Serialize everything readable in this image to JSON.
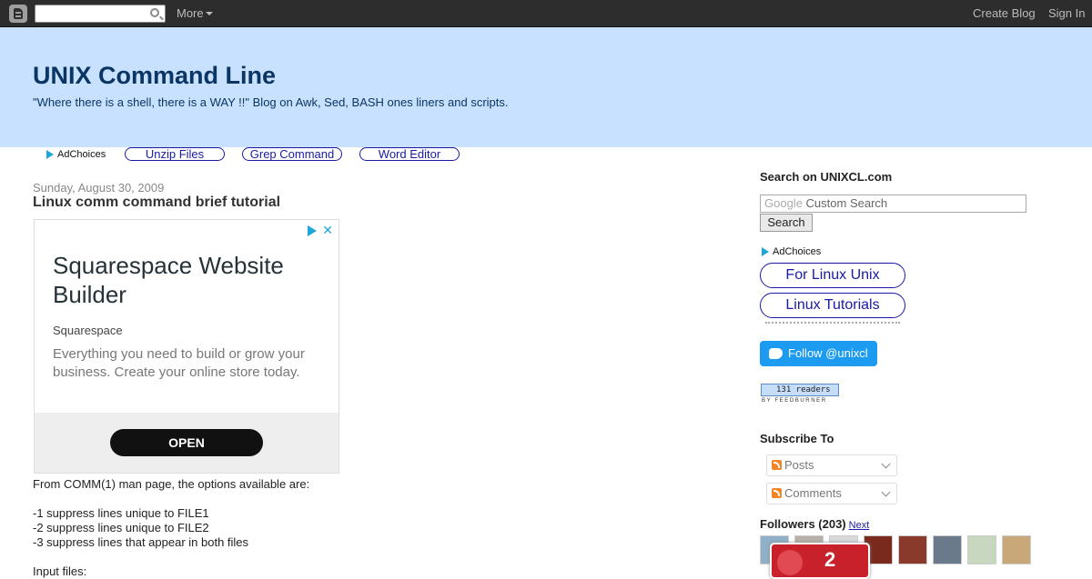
{
  "navbar": {
    "more_label": "More",
    "create_blog_label": "Create Blog",
    "sign_in_label": "Sign In"
  },
  "header": {
    "title": "UNIX Command Line",
    "description": "\"Where there is a shell, there is a WAY !!\" Blog on Awk, Sed, BASH ones liners and scripts."
  },
  "top_ad_links": {
    "adchoices_label": "AdChoices",
    "links": [
      "Unzip Files",
      "Grep Command",
      "Word Editor"
    ]
  },
  "post": {
    "date": "Sunday, August 30, 2009",
    "title": "Linux comm command brief tutorial",
    "body_lines": [
      "From COMM(1) man page, the options available are:",
      "",
      "-1 suppress lines unique to FILE1",
      "-2 suppress lines unique to FILE2",
      "-3 suppress lines that appear in both files",
      "",
      "Input files:"
    ]
  },
  "ad": {
    "headline": "Squarespace Website Builder",
    "advertiser": "Squarespace",
    "body": "Everything you need to build or grow your business. Create your online store today.",
    "cta": "OPEN",
    "close_glyph": "✕"
  },
  "sidebar": {
    "search_heading": "Search on UNIXCL.com",
    "search_google_label": "Google",
    "search_placeholder": "Custom Search",
    "search_button": "Search",
    "adchoices_label": "AdChoices",
    "ad_links": [
      "For Linux Unix",
      "Linux Tutorials"
    ],
    "twitter_label": "Follow @unixcl",
    "feedburner_count": "131 readers",
    "feedburner_by": "BY FEEDBURNER",
    "subscribe_heading": "Subscribe To",
    "subscribe_options": [
      "Posts",
      "Comments"
    ],
    "followers_heading": "Followers (203)",
    "followers_next": "Next",
    "notification_count": "2"
  },
  "colors": {
    "navbar_bg": "#2d2d2d",
    "header_bg": "#c7e1ff",
    "title_color": "#0b3563",
    "link_color": "#1a1aa6",
    "twitter_blue": "#1d9bf0",
    "badge_red": "#c8212b"
  },
  "icons": [
    "blogger-logo-icon",
    "search-icon",
    "chevron-down-icon",
    "adchoices-icon",
    "close-icon",
    "twitter-icon",
    "rss-icon"
  ]
}
